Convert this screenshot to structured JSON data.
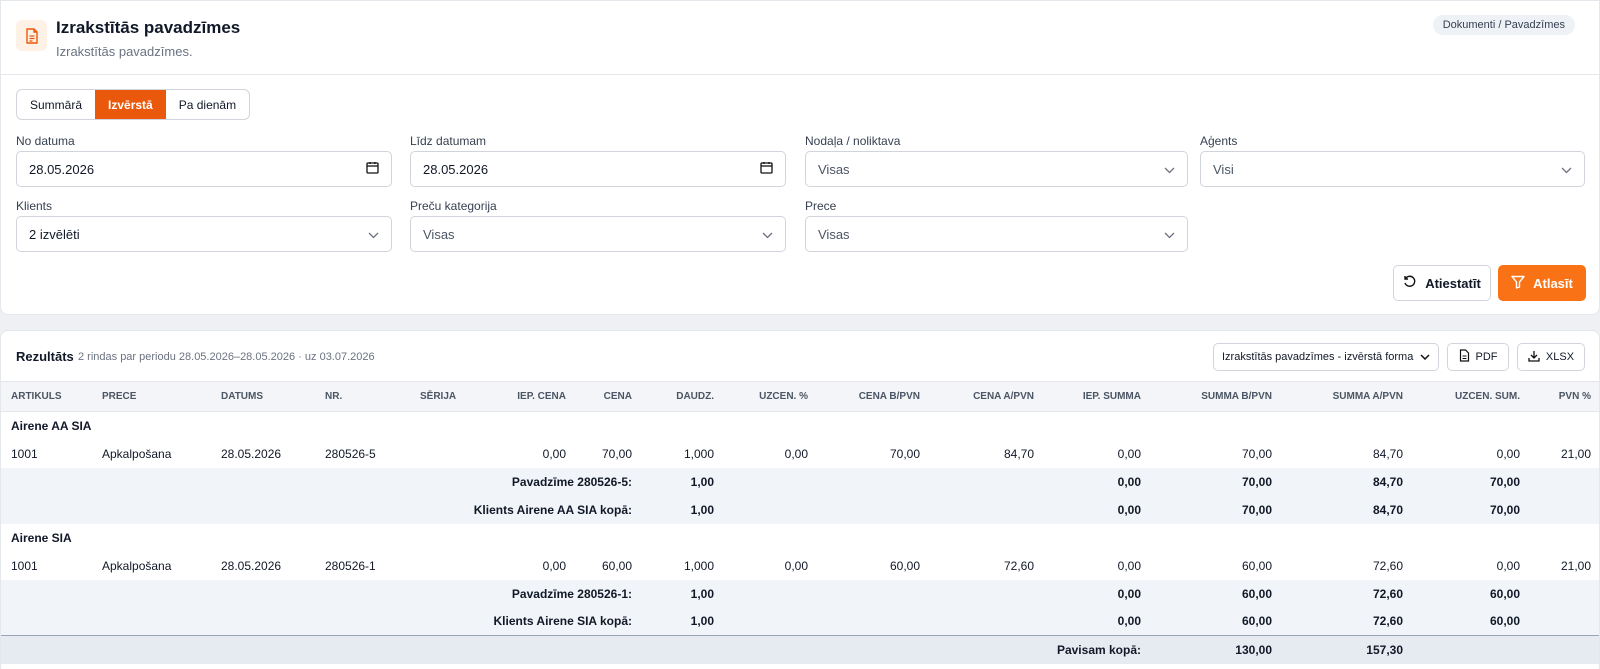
{
  "header": {
    "title": "Izrakstītās pavadzīmes",
    "subtitle": "Izrakstītās pavadzīmes.",
    "breadcrumb": "Dokumenti / Pavadzīmes"
  },
  "view_tabs": [
    {
      "label": "Summārā",
      "active": false
    },
    {
      "label": "Izvērstā",
      "active": true
    },
    {
      "label": "Pa dienām",
      "active": false
    }
  ],
  "filters": {
    "from_label": "No datuma",
    "from_value": "28.05.2026",
    "to_label": "Līdz datumam",
    "to_value": "28.05.2026",
    "department_label": "Nodaļa / noliktava",
    "department_value": "Visas",
    "agent_label": "Aģents",
    "agent_value": "Visi",
    "client_label": "Klients",
    "client_value": "2 izvēlēti",
    "category_label": "Preču kategorija",
    "category_value": "Visas",
    "product_label": "Prece",
    "product_value": "Visas",
    "reset_label": "Atiestatīt",
    "apply_label": "Atlasīt"
  },
  "results": {
    "title": "Rezultāts",
    "meta": "2 rindas par periodu 28.05.2026–28.05.2026 · uz 03.07.2026",
    "report_select": "Izrakstītās pavadzīmes - izvērstā forma",
    "pdf_label": "PDF",
    "xlsx_label": "XLSX",
    "columns": [
      "Artikuls",
      "Prece",
      "Datums",
      "Nr.",
      "Sērija",
      "Iep. cena",
      "Cena",
      "Daudz.",
      "Uzcen. %",
      "Cena b/PVN",
      "Cena a/PVN",
      "Iep. summa",
      "Summa b/PVN",
      "Summa a/PVN",
      "Uzcen. sum.",
      "PVN %"
    ],
    "groups": [
      {
        "client": "Airene AA SIA",
        "row": [
          "1001",
          "Apkalpošana",
          "28.05.2026",
          "280526-5",
          "",
          "0,00",
          "70,00",
          "1,000",
          "0,00",
          "70,00",
          "84,70",
          "0,00",
          "70,00",
          "84,70",
          "0,00",
          "21,00"
        ],
        "invoice_label": "Pavadzīme 280526-5:",
        "invoice_vals": {
          "qty": "1,00",
          "iep": "0,00",
          "sbp": "70,00",
          "sap": "84,70",
          "uzs": "70,00"
        },
        "client_label": "Klients Airene AA SIA kopā:",
        "client_vals": {
          "qty": "1,00",
          "iep": "0,00",
          "sbp": "70,00",
          "sap": "84,70",
          "uzs": "70,00"
        }
      },
      {
        "client": "Airene SIA",
        "row": [
          "1001",
          "Apkalpošana",
          "28.05.2026",
          "280526-1",
          "",
          "0,00",
          "60,00",
          "1,000",
          "0,00",
          "60,00",
          "72,60",
          "0,00",
          "60,00",
          "72,60",
          "0,00",
          "21,00"
        ],
        "invoice_label": "Pavadzīme 280526-1:",
        "invoice_vals": {
          "qty": "1,00",
          "iep": "0,00",
          "sbp": "60,00",
          "sap": "72,60",
          "uzs": "60,00"
        },
        "client_label": "Klients Airene SIA kopā:",
        "client_vals": {
          "qty": "1,00",
          "iep": "0,00",
          "sbp": "60,00",
          "sap": "72,60",
          "uzs": "60,00"
        }
      }
    ],
    "total_label": "Pavisam kopā:",
    "total_vals": {
      "sbp": "130,00",
      "sap": "157,30"
    }
  },
  "colors": {
    "accent": "#ea580c",
    "accent_button": "#f97316",
    "icon_bg": "#fff1e6"
  }
}
